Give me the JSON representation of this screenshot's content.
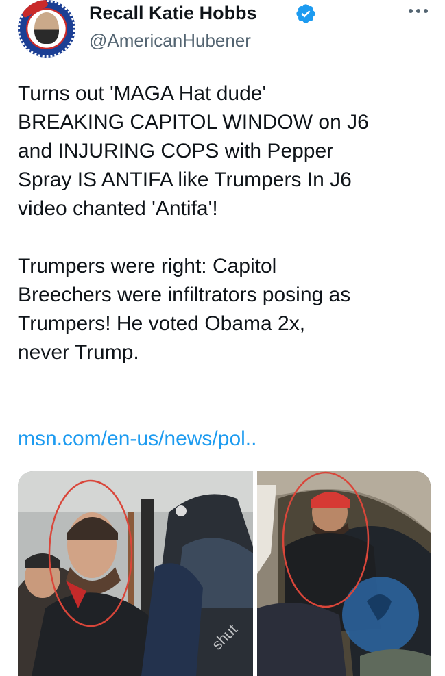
{
  "author": {
    "display_name": "Recall Katie Hobbs",
    "handle": "@AmericanHubener",
    "verified_icon": "verified-badge-icon",
    "avatar_icon": "avatar-portrait"
  },
  "more_icon": "more-options-icon",
  "tweet": {
    "text": "Turns out 'MAGA Hat dude'\nBREAKING CAPITOL WINDOW on J6\nand INJURING COPS with Pepper\nSpray IS ANTIFA like Trumpers In J6\nvideo chanted 'Antifa'!\n\nTrumpers were right: Capitol\nBreechers were infiltrators posing as\nTrumpers! He voted Obama 2x,\nnever Trump.",
    "link": "msn.com/en-us/news/pol.."
  },
  "media": {
    "left_watermark": "shut",
    "colors": {
      "link": "#1d9bf0",
      "verified": "#1d9bf0",
      "circle_annotation": "#d9463a"
    }
  }
}
